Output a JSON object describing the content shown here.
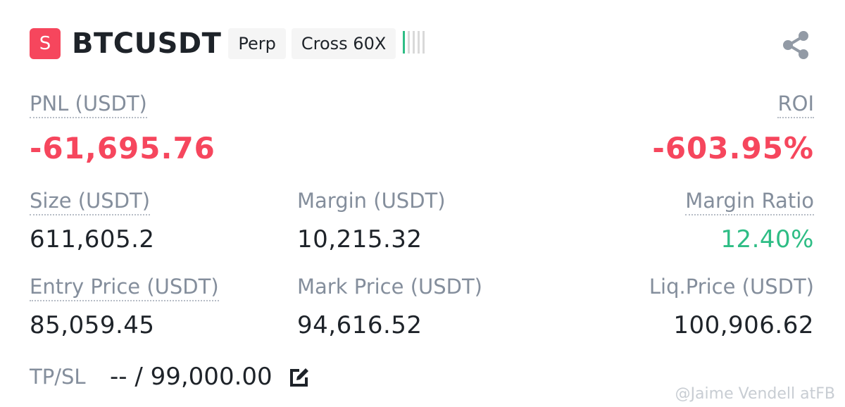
{
  "header": {
    "side_badge": "S",
    "symbol": "BTCUSDT",
    "type_tag": "Perp",
    "margin_tag": "Cross 60X",
    "leverage_icon": "leverage-bars-icon",
    "share_icon": "share-icon"
  },
  "pnl": {
    "label": "PNL (USDT)",
    "value": "-61,695.76"
  },
  "roi": {
    "label": "ROI",
    "value": "-603.95%"
  },
  "size": {
    "label": "Size (USDT)",
    "value": "611,605.2"
  },
  "margin": {
    "label": "Margin (USDT)",
    "value": "10,215.32"
  },
  "margin_ratio": {
    "label": "Margin Ratio",
    "value": "12.40%"
  },
  "entry_price": {
    "label": "Entry Price (USDT)",
    "value": "85,059.45"
  },
  "mark_price": {
    "label": "Mark Price (USDT)",
    "value": "94,616.52"
  },
  "liq_price": {
    "label": "Liq.Price (USDT)",
    "value": "100,906.62"
  },
  "tpsl": {
    "label": "TP/SL",
    "value": "-- / 99,000.00",
    "edit_icon": "edit-icon"
  },
  "watermark": "@Jaime Vendell atFB",
  "colors": {
    "loss": "#f6465d",
    "gain": "#2ebd85",
    "label": "#848e9c",
    "text": "#1e2329"
  }
}
